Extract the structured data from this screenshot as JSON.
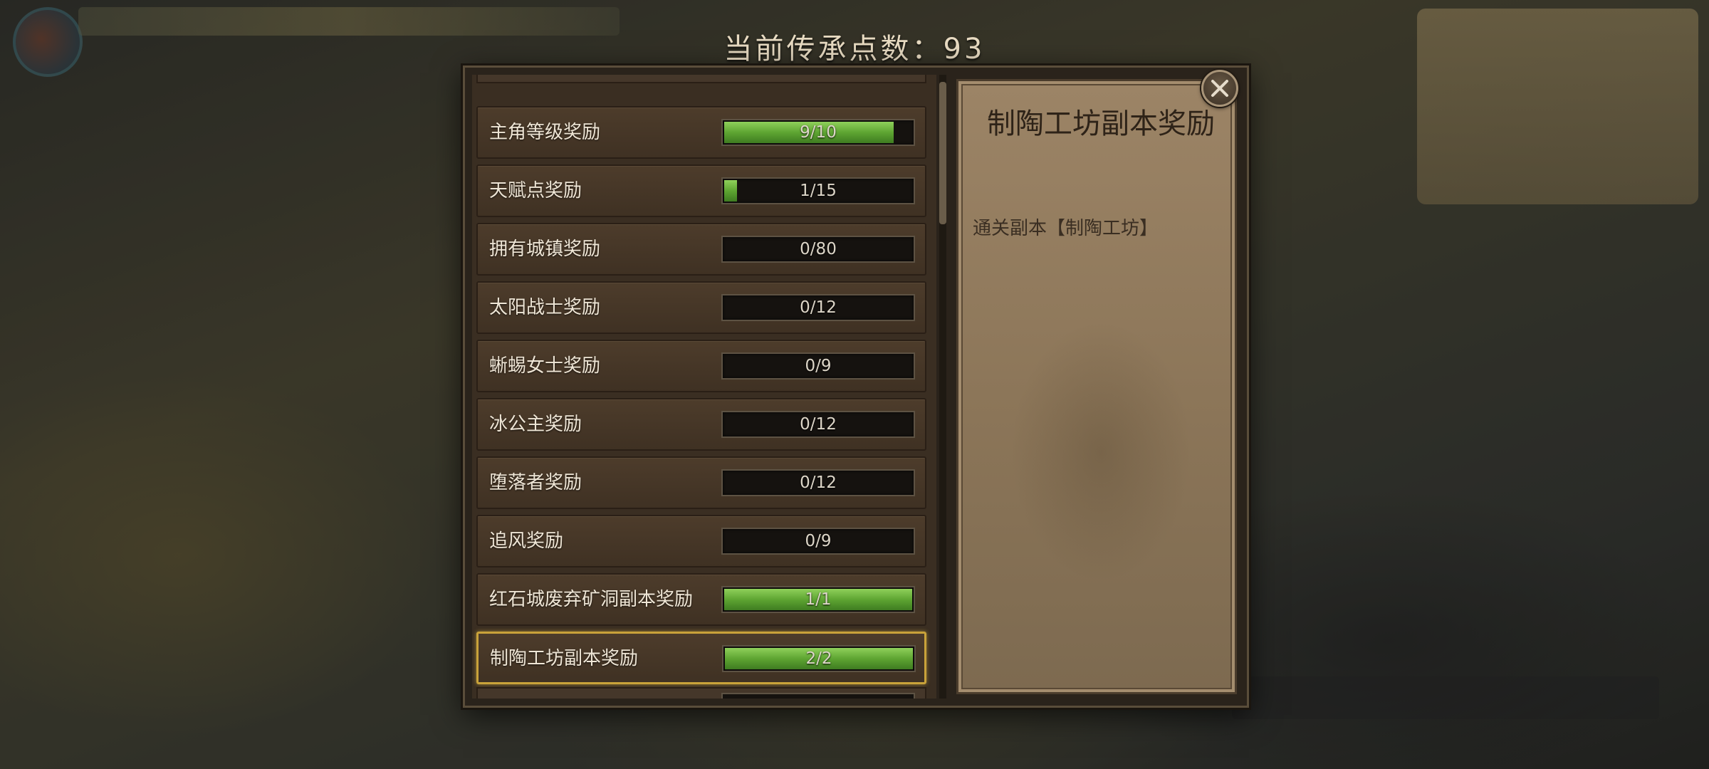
{
  "header": {
    "points_text": "当前传承点数：93"
  },
  "rewards": [
    {
      "label": "主角等级奖励",
      "progress": "9/10",
      "fraction": 0.9,
      "selected": false
    },
    {
      "label": "天赋点奖励",
      "progress": "1/15",
      "fraction": 0.0667,
      "selected": false
    },
    {
      "label": "拥有城镇奖励",
      "progress": "0/80",
      "fraction": 0,
      "selected": false
    },
    {
      "label": "太阳战士奖励",
      "progress": "0/12",
      "fraction": 0,
      "selected": false
    },
    {
      "label": "蜥蜴女士奖励",
      "progress": "0/9",
      "fraction": 0,
      "selected": false
    },
    {
      "label": "冰公主奖励",
      "progress": "0/12",
      "fraction": 0,
      "selected": false
    },
    {
      "label": "堕落者奖励",
      "progress": "0/12",
      "fraction": 0,
      "selected": false
    },
    {
      "label": "追风奖励",
      "progress": "0/9",
      "fraction": 0,
      "selected": false
    },
    {
      "label": "红石城废弃矿洞副本奖励",
      "progress": "1/1",
      "fraction": 1,
      "selected": false
    },
    {
      "label": "制陶工坊副本奖励",
      "progress": "2/2",
      "fraction": 1,
      "selected": true
    }
  ],
  "detail": {
    "title": "制陶工坊副本奖励",
    "description": "通关副本【制陶工坊】"
  },
  "colors": {
    "bar_fill": "#5ea532",
    "selected_border": "#c9a23a",
    "header_text": "#e9dcc3"
  },
  "icons": {
    "close": "close-icon"
  }
}
